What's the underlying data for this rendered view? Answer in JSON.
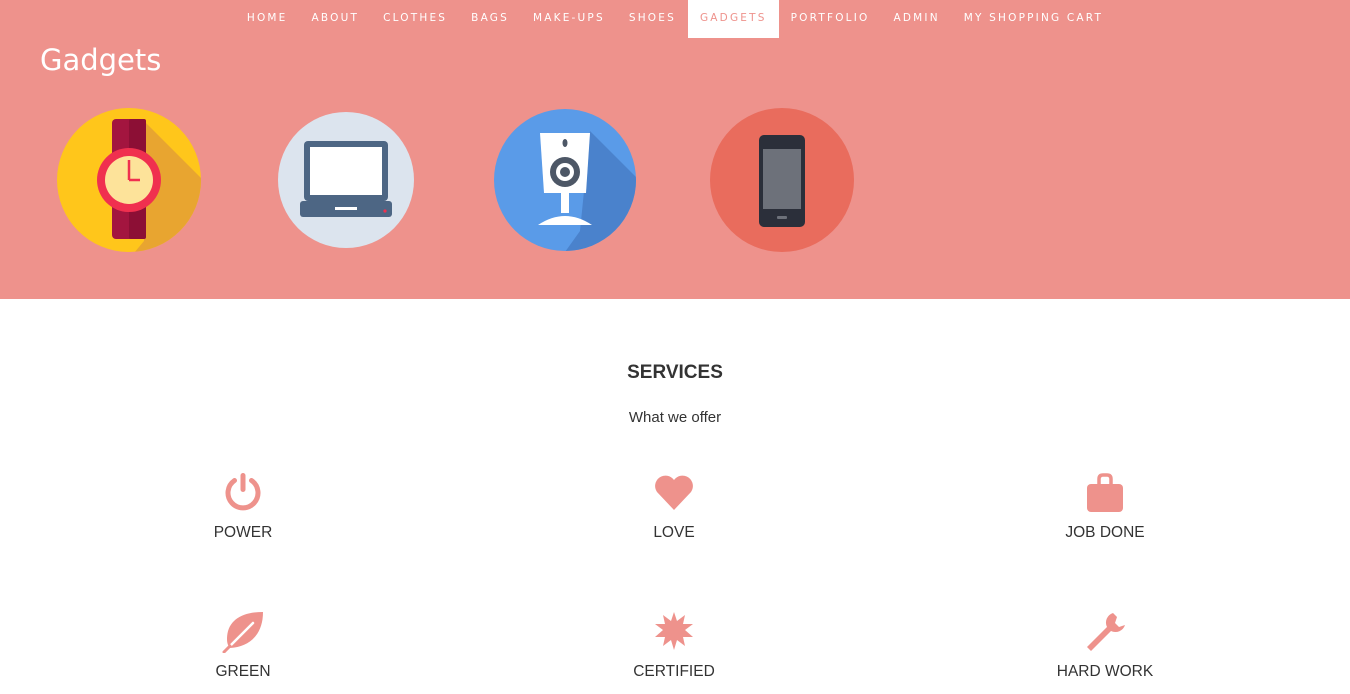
{
  "nav": {
    "items": [
      {
        "label": "HOME"
      },
      {
        "label": "ABOUT"
      },
      {
        "label": "CLOTHES"
      },
      {
        "label": "BAGS"
      },
      {
        "label": "MAKE-UPS"
      },
      {
        "label": "SHOES"
      },
      {
        "label": "GADGETS",
        "active": true
      },
      {
        "label": "PORTFOLIO"
      },
      {
        "label": "ADMIN"
      },
      {
        "label": "MY SHOPPING CART"
      }
    ]
  },
  "hero": {
    "title": "Gadgets",
    "background": "#ee928c",
    "gadgets": [
      {
        "icon": "wristwatch-icon"
      },
      {
        "icon": "laptop-icon"
      },
      {
        "icon": "webcam-icon"
      },
      {
        "icon": "smartphone-icon"
      }
    ]
  },
  "services": {
    "title": "SERVICES",
    "subtitle": "What we offer",
    "accent": "#ee928c",
    "items": [
      {
        "label": "POWER",
        "icon": "power-icon"
      },
      {
        "label": "LOVE",
        "icon": "heart-icon"
      },
      {
        "label": "JOB DONE",
        "icon": "briefcase-icon"
      },
      {
        "label": "GREEN",
        "icon": "leaf-icon"
      },
      {
        "label": "CERTIFIED",
        "icon": "certified-badge-icon"
      },
      {
        "label": "HARD WORK",
        "icon": "wrench-icon"
      }
    ]
  }
}
